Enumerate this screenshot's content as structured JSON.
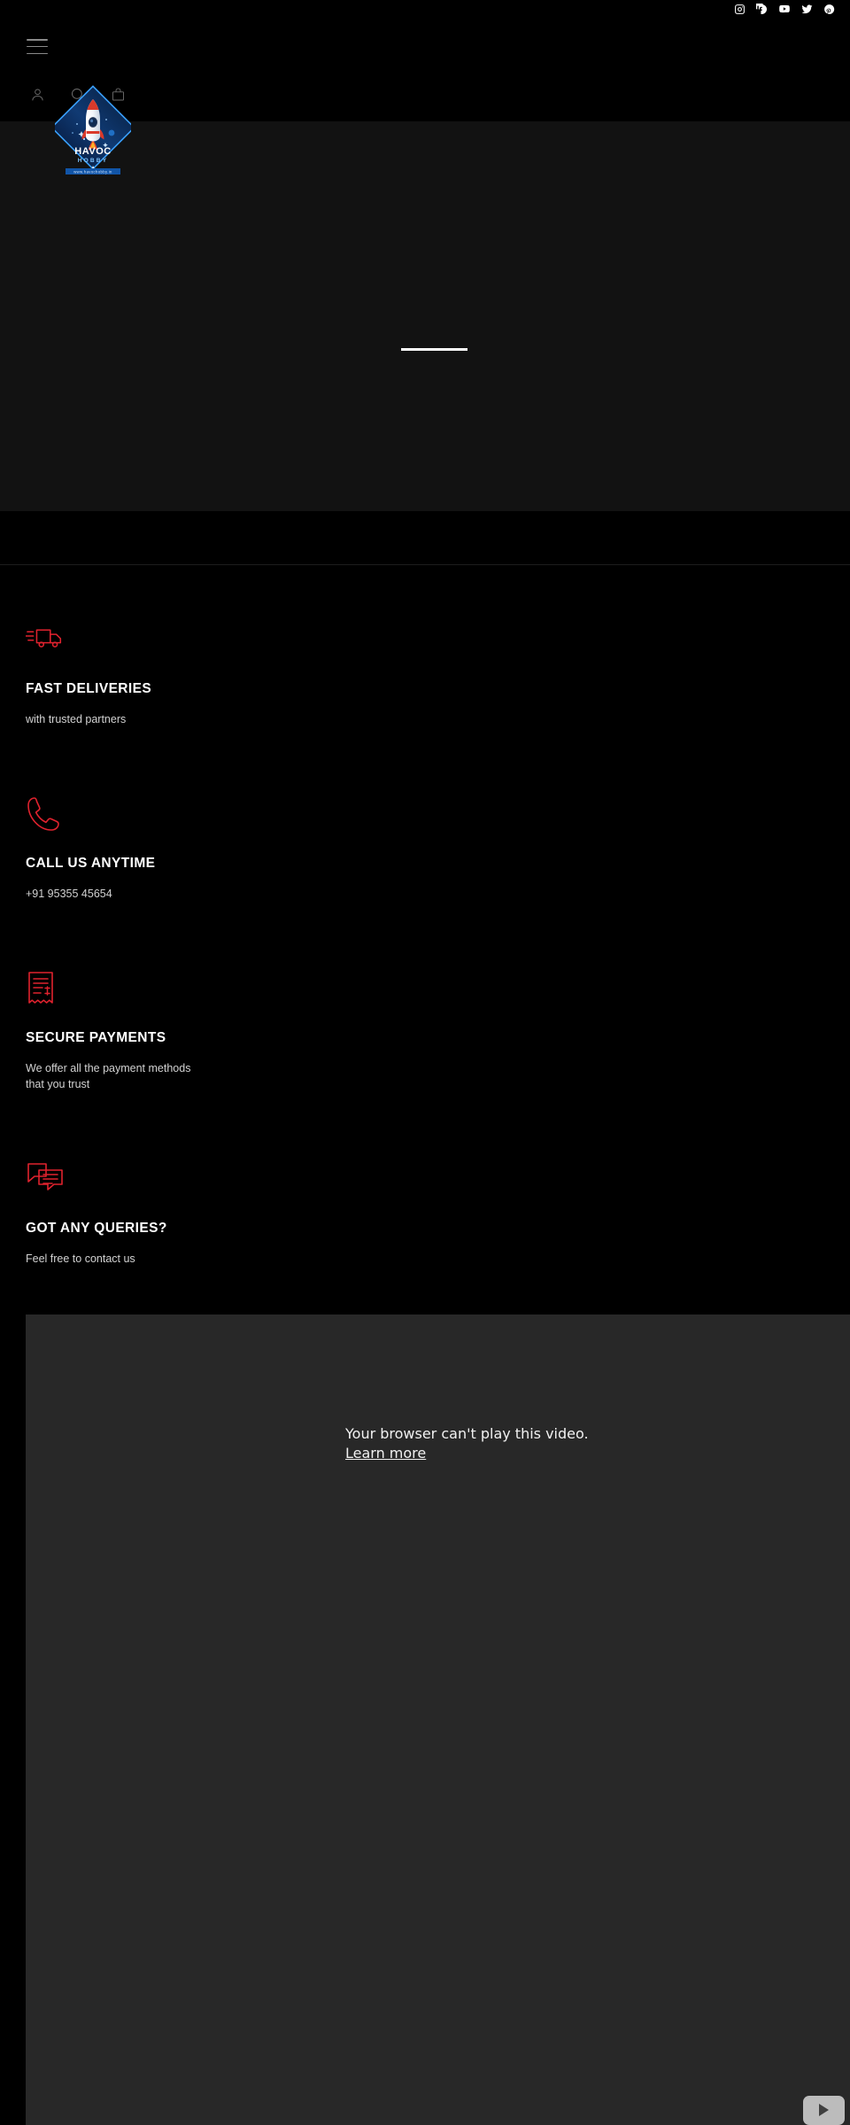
{
  "site": {
    "brand": "HAVOC HOBBY",
    "brand_line1": "HAVOC",
    "brand_line2": "HOBBY",
    "url": "www.havochobby.in"
  },
  "social": {
    "items": [
      {
        "name": "instagram-icon",
        "label": "Instagram"
      },
      {
        "name": "facebook-icon",
        "label": "Facebook"
      },
      {
        "name": "youtube-icon",
        "label": "YouTube"
      },
      {
        "name": "twitter-icon",
        "label": "Twitter"
      },
      {
        "name": "pinterest-icon",
        "label": "Pinterest"
      }
    ]
  },
  "header": {
    "menu_label": "Menu",
    "account_label": "Account",
    "search_label": "Search",
    "cart_label": "Cart"
  },
  "features": [
    {
      "icon": "delivery-truck-icon",
      "title": "FAST DELIVERIES",
      "subtitle": "with trusted partners"
    },
    {
      "icon": "phone-icon",
      "title": "CALL US ANYTIME",
      "subtitle": "+91 95355 45654"
    },
    {
      "icon": "receipt-icon",
      "title": "SECURE PAYMENTS",
      "subtitle": "We offer all the payment methods\nthat you trust"
    },
    {
      "icon": "chat-bubbles-icon",
      "title": "GOT ANY QUERIES?",
      "subtitle": "Feel free to contact us"
    }
  ],
  "video": {
    "error_text": "Your browser can't play this video.",
    "learn_more": "Learn more",
    "play_label": "Play"
  },
  "colors": {
    "accent_red": "#e0222e",
    "hero_bg": "#121212",
    "page_bg": "#000000",
    "video_bg": "#282828",
    "logo_blue": "#1a5fb4"
  }
}
